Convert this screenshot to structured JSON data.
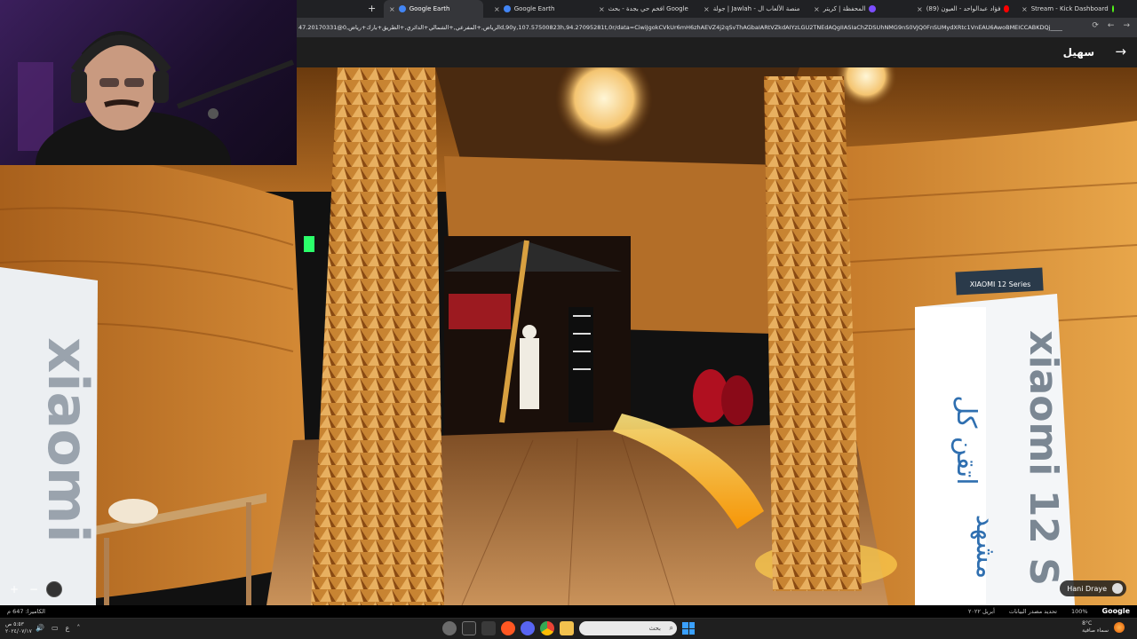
{
  "browser": {
    "new_tab": "+",
    "tabs": [
      {
        "title": "Google Earth",
        "active": true,
        "fav": "#4285f4"
      },
      {
        "title": "Google Earth",
        "active": false,
        "fav": "#4285f4"
      },
      {
        "title": "افخم حي بجدة - بحث Google",
        "active": false,
        "fav": "#ffffff"
      },
      {
        "title": "جولة | Jawlah - منصة الألعاب ال",
        "active": false,
        "fav": "#e53935"
      },
      {
        "title": "المحفظة | كريتر",
        "active": false,
        "fav": "#7c4dff"
      },
      {
        "title": "(89) فؤاد عبدالواحد - العيون",
        "active": false,
        "fav": "#ff0000"
      },
      {
        "title": "Stream - Kick Dashboard",
        "active": false,
        "fav": "#53fc18"
      }
    ],
    "close_glyph": "×",
    "url": "47.20170331@الرياض,+المفرعي,+الشمالي+الدائري,+الطريق+بارك+رياض,0d,90y,107.57500823h,94.27095281t,0r/data=CiwiJgokCVkUr6mH6zhAEVZ4j2qSvThAGbaIARtVZkdAIYzLGU2TNEdAQgIIASIaChZDSUhNMG9nS0VJQ0FnSUMydXRtc1VnEAU6AwoBMEICCABKDQj_______8BEAA",
    "address_icons": [
      "reload-icon",
      "back-icon",
      "forward-icon"
    ]
  },
  "earth": {
    "place_title": "سهيل",
    "back_glyph": "→",
    "zoom_in": "+",
    "zoom_out": "−",
    "photo_credit": "Hani Draye",
    "status": {
      "camera": "الكاميرا: 647 م",
      "date": "أبريل ٢٠٢٢",
      "data_source": "تحديد مصدر البيانات",
      "zoom_pct": "100%",
      "logo": "Google"
    }
  },
  "scene": {
    "sign_left": "xiaomi",
    "sign_right_brand": "xiaomi 12 S",
    "sign_right_arabic_1": "اتقن كل",
    "sign_right_arabic_2": "مشهد",
    "sign_top": "XIAOMI 12 Series"
  },
  "taskbar": {
    "time": "٥:٥٣ ص",
    "date": "٢٠٢٤/٠٧/١٧",
    "lang": "ع",
    "search_placeholder": "بحث",
    "weather_temp": "8°C",
    "weather_desc": "سماء صافية"
  },
  "colors": {
    "wood_light": "#e8a64a",
    "wood_dark": "#8a4a12",
    "glow": "#ffcf4d"
  }
}
